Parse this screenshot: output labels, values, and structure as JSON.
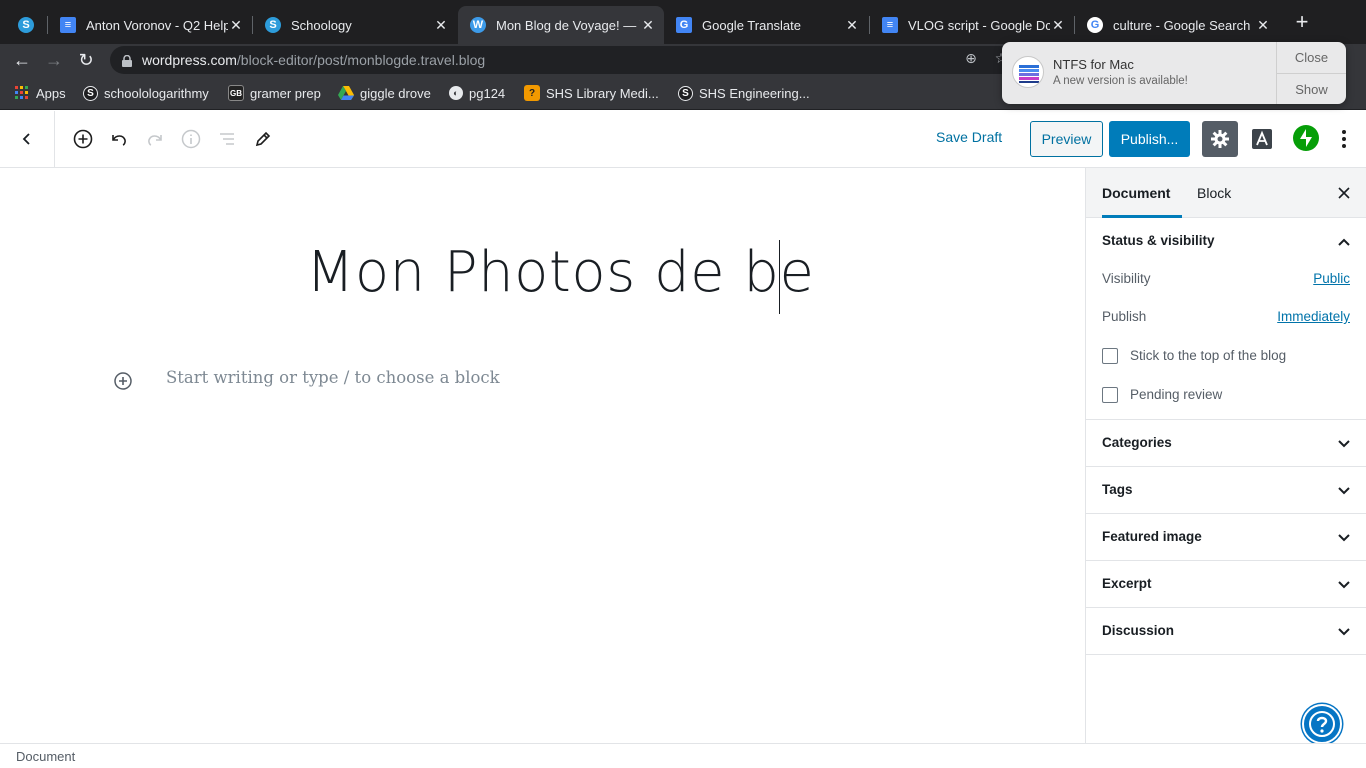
{
  "browser": {
    "tabs": [
      {
        "title": "",
        "icon": "schoology-icon",
        "color": "#2d9cdb",
        "active": false
      },
      {
        "title": "Anton Voronov - Q2 Help",
        "icon": "google-docs-icon",
        "color": "#4285f4",
        "active": false
      },
      {
        "title": "Schoology",
        "icon": "schoology-icon",
        "color": "#2d9cdb",
        "active": false
      },
      {
        "title": "Mon Blog de Voyage! — \\",
        "icon": "wordpress-icon",
        "color": "#3d9be9",
        "active": true
      },
      {
        "title": "Google Translate",
        "icon": "google-translate-icon",
        "color": "#4285f4",
        "active": false
      },
      {
        "title": "VLOG script - Google Dc",
        "icon": "google-docs-icon",
        "color": "#4285f4",
        "active": false
      },
      {
        "title": "culture - Google Search",
        "icon": "google-icon",
        "color": "#ea4335",
        "active": false
      }
    ],
    "url_host": "wordpress.com",
    "url_path": "/block-editor/post/monblogde.travel.blog",
    "bookmarks": [
      {
        "label": "Apps",
        "icon": "apps-grid-icon"
      },
      {
        "label": "schoolologarithmy",
        "icon": "schoology-icon"
      },
      {
        "label": "gramer prep",
        "icon": "gb-logo-icon"
      },
      {
        "label": "giggle drove",
        "icon": "google-drive-icon"
      },
      {
        "label": "pg124",
        "icon": "globe-icon"
      },
      {
        "label": "SHS Library Medi...",
        "icon": "library-icon"
      },
      {
        "label": "SHS Engineering...",
        "icon": "schoology-icon"
      }
    ]
  },
  "notification": {
    "title": "NTFS for Mac",
    "subtitle": "A new version is available!",
    "close_label": "Close",
    "show_label": "Show"
  },
  "editor": {
    "save_draft": "Save Draft",
    "preview": "Preview",
    "publish": "Publish...",
    "post_title": "Mon Photos de be",
    "placeholder": "Start writing or type / to choose a block",
    "accent": "#007cba"
  },
  "sidebar": {
    "tabs": [
      "Document",
      "Block"
    ],
    "status_heading": "Status & visibility",
    "visibility_label": "Visibility",
    "visibility_value": "Public",
    "publish_label": "Publish",
    "publish_value": "Immediately",
    "stick_label": "Stick to the top of the blog",
    "pending_label": "Pending review",
    "panels": [
      "Categories",
      "Tags",
      "Featured image",
      "Excerpt",
      "Discussion"
    ]
  },
  "footer": {
    "breadcrumb": "Document"
  }
}
